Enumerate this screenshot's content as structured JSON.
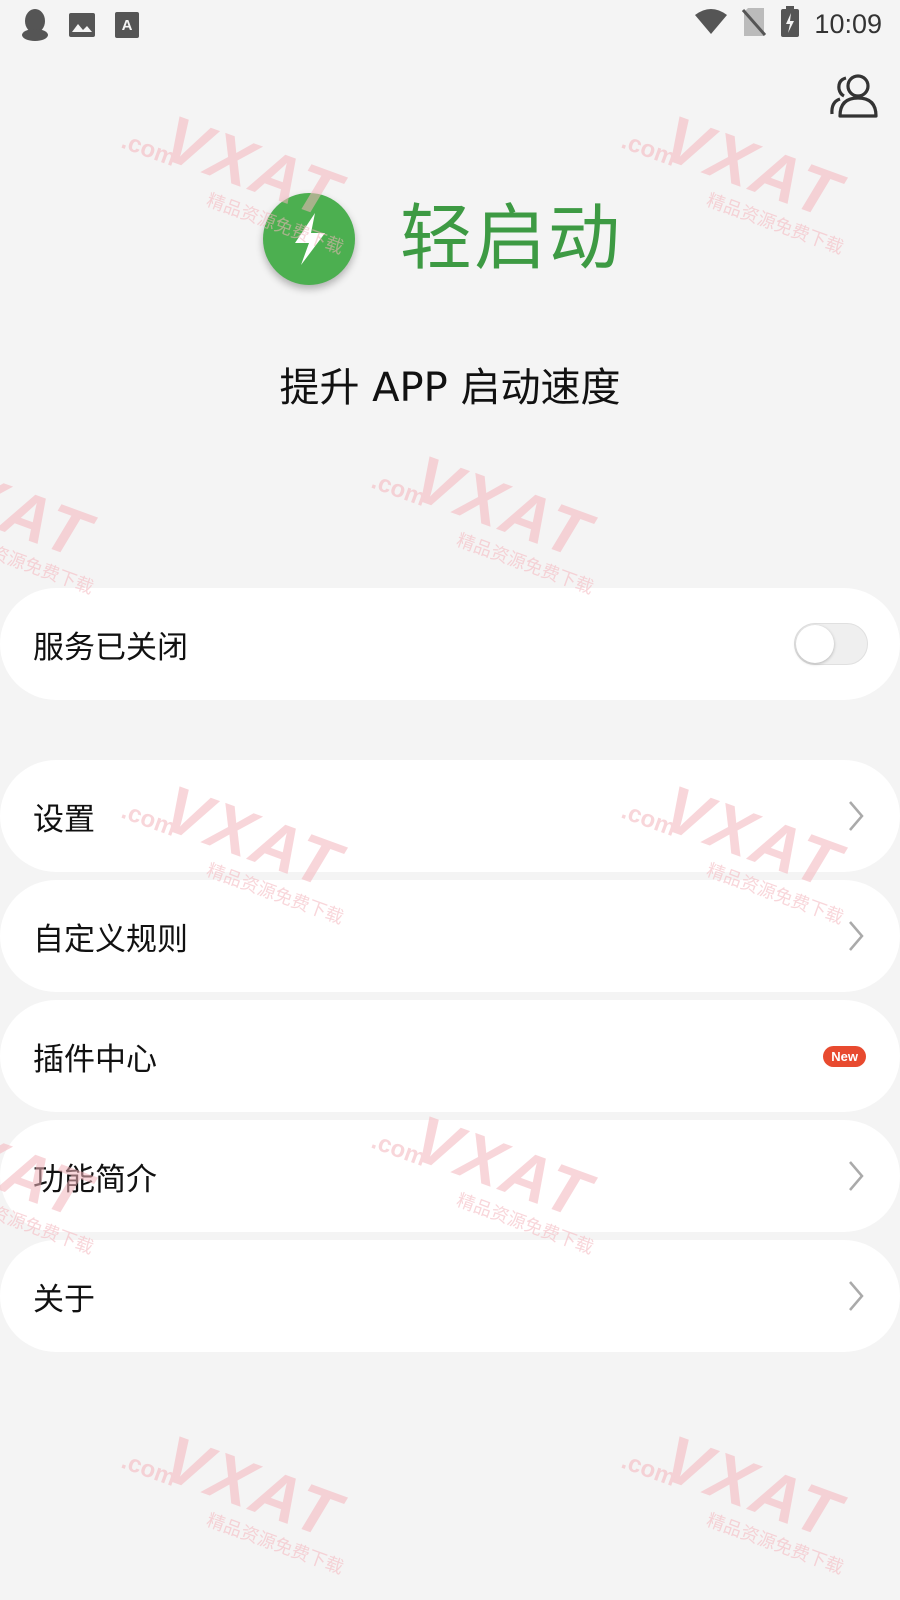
{
  "status_bar": {
    "time": "10:09",
    "left_icons": [
      "qq-icon",
      "image-icon",
      "font-icon"
    ],
    "right_icons": [
      "wifi-icon",
      "no-sim-icon",
      "battery-charging-icon"
    ]
  },
  "header": {
    "profile_icon": "users-icon"
  },
  "hero": {
    "app_name": "轻启动",
    "tagline": "提升 APP 启动速度",
    "logo_icon": "lightning-bolt-icon",
    "logo_color": "#4caf50",
    "name_color": "#3d9a43"
  },
  "service": {
    "label": "服务已关闭",
    "enabled": false
  },
  "menu": {
    "settings": "设置",
    "custom_rules": "自定义规则",
    "plugin_center": "插件中心",
    "plugin_badge": "New",
    "features": "功能简介",
    "about": "关于"
  },
  "watermark": {
    "text": "VXAT",
    "domain": ".com",
    "subtitle": "精品资源免费下载"
  }
}
